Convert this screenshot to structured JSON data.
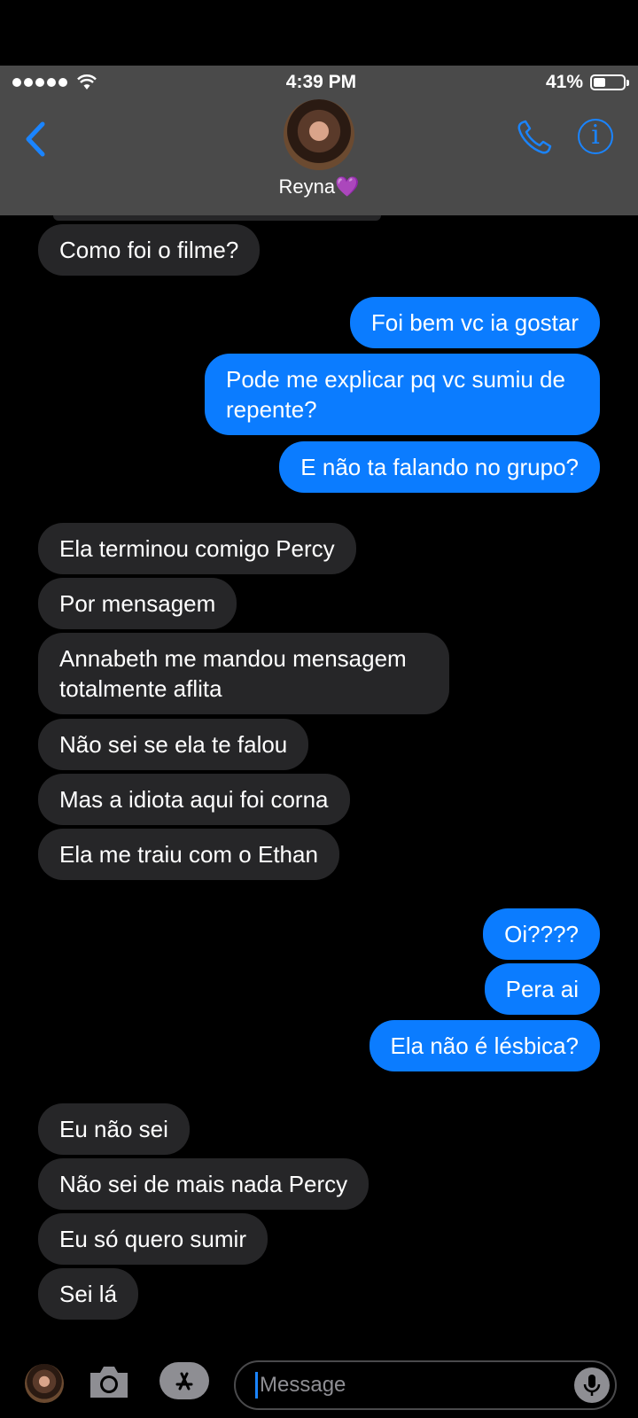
{
  "status_bar": {
    "time": "4:39 PM",
    "battery": "41%",
    "battery_level": 0.41
  },
  "header": {
    "contact_name": "Reyna💜"
  },
  "messages": [
    {
      "dir": "in",
      "text": "Como foi o filme?"
    },
    {
      "dir": "out",
      "text": "Foi bem vc ia gostar"
    },
    {
      "dir": "out",
      "text": "Pode me explicar pq vc sumiu de repente?"
    },
    {
      "dir": "out",
      "text": "E não ta falando no grupo?"
    },
    {
      "dir": "in",
      "text": "Ela terminou comigo Percy"
    },
    {
      "dir": "in",
      "text": "Por mensagem"
    },
    {
      "dir": "in",
      "text": "Annabeth me mandou mensagem totalmente aflita"
    },
    {
      "dir": "in",
      "text": "Não sei se ela te falou"
    },
    {
      "dir": "in",
      "text": "Mas a idiota aqui foi corna"
    },
    {
      "dir": "in",
      "text": "Ela me traiu com o Ethan"
    },
    {
      "dir": "out",
      "text": "Oi????"
    },
    {
      "dir": "out",
      "text": "Pera ai"
    },
    {
      "dir": "out",
      "text": "Ela não é lésbica?"
    },
    {
      "dir": "in",
      "text": "Eu não sei"
    },
    {
      "dir": "in",
      "text": "Não sei de mais nada Percy"
    },
    {
      "dir": "in",
      "text": "Eu só quero sumir"
    },
    {
      "dir": "in",
      "text": "Sei lá"
    }
  ],
  "composer": {
    "placeholder": "Message"
  },
  "colors": {
    "incoming": "#262628",
    "outgoing": "#0b7cff",
    "accent": "#1a84ff",
    "bar": "#4a4a4a"
  },
  "icons": [
    "back-chevron-icon",
    "phone-icon",
    "info-icon",
    "camera-icon",
    "app-store-icon",
    "microphone-icon"
  ]
}
